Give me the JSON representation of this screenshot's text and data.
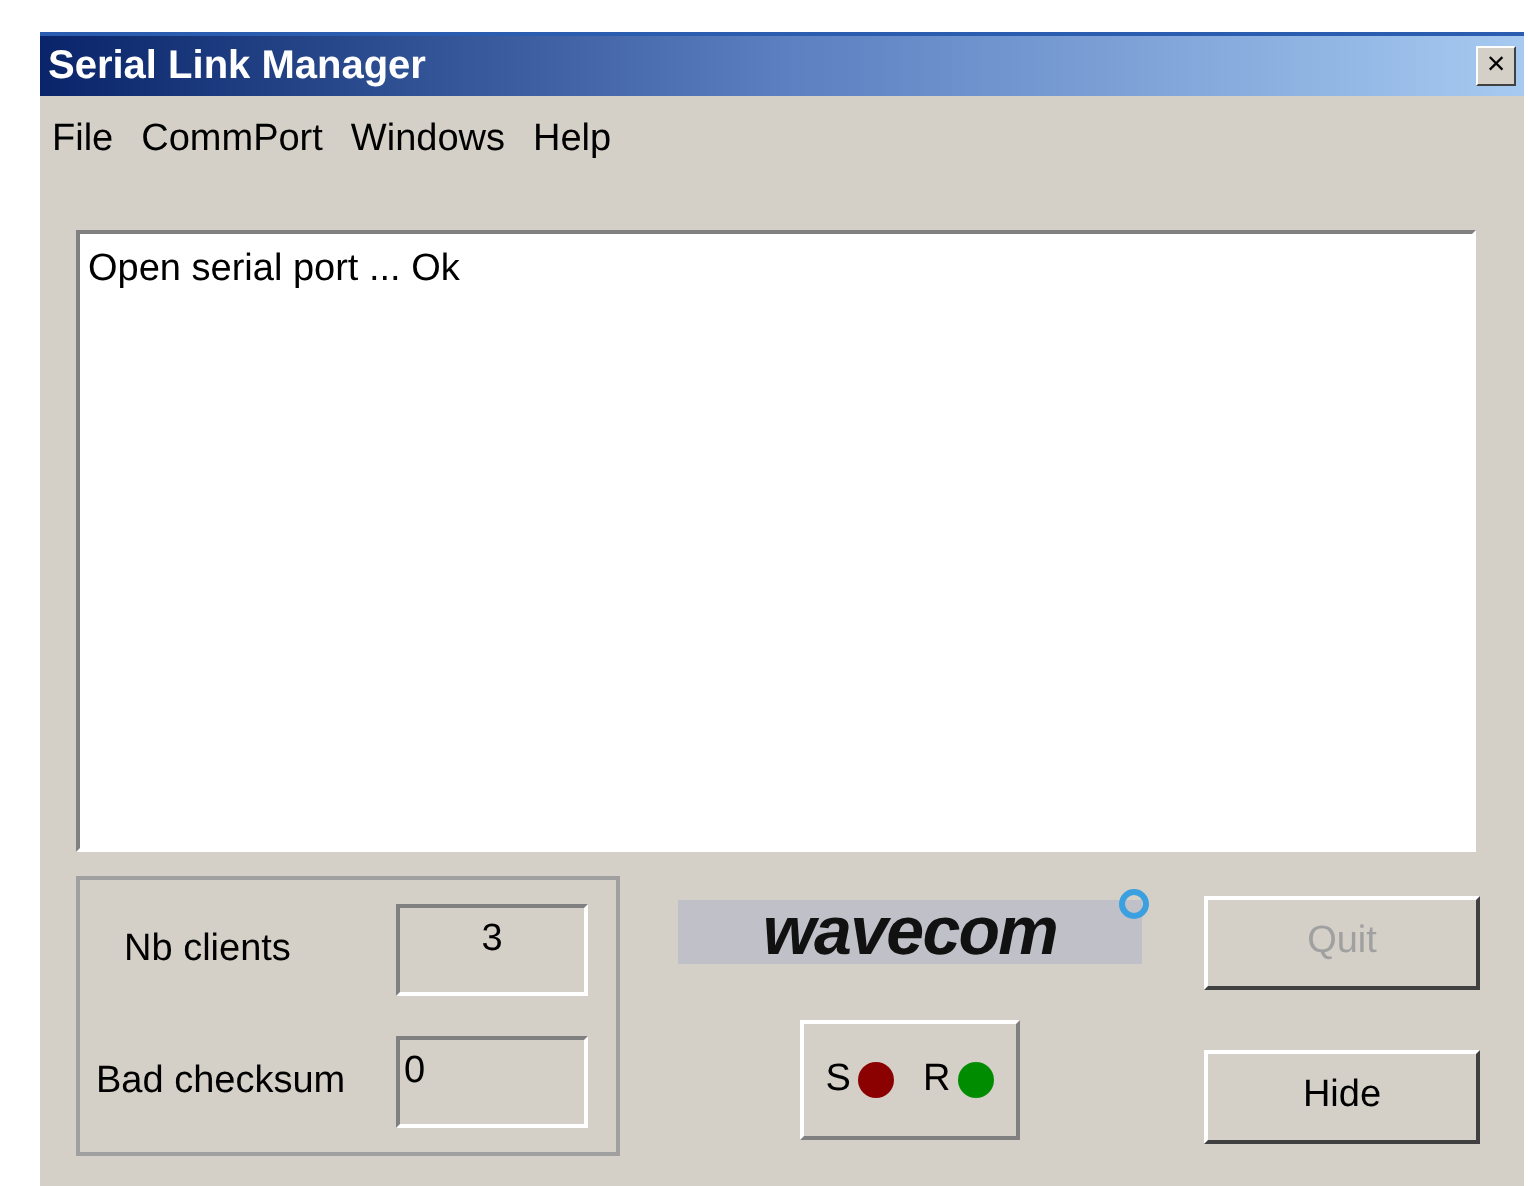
{
  "window": {
    "title": "Serial Link Manager",
    "close": "×"
  },
  "menu": [
    "File",
    "CommPort",
    "Windows",
    "Help"
  ],
  "log": {
    "lines": [
      "Open serial port ... Ok"
    ]
  },
  "stats": [
    {
      "label": "Nb clients",
      "value": "3",
      "kind": "centered"
    },
    {
      "label": "Bad checksum",
      "value": "0",
      "kind": "plain"
    }
  ],
  "logo": {
    "text": "wavecom"
  },
  "leds": [
    {
      "label": "S",
      "color": "#8b0000"
    },
    {
      "label": "R",
      "color": "#008c00"
    }
  ],
  "buttons": [
    {
      "label": "Quit",
      "disabled": true
    },
    {
      "label": "Hide",
      "disabled": false
    }
  ]
}
